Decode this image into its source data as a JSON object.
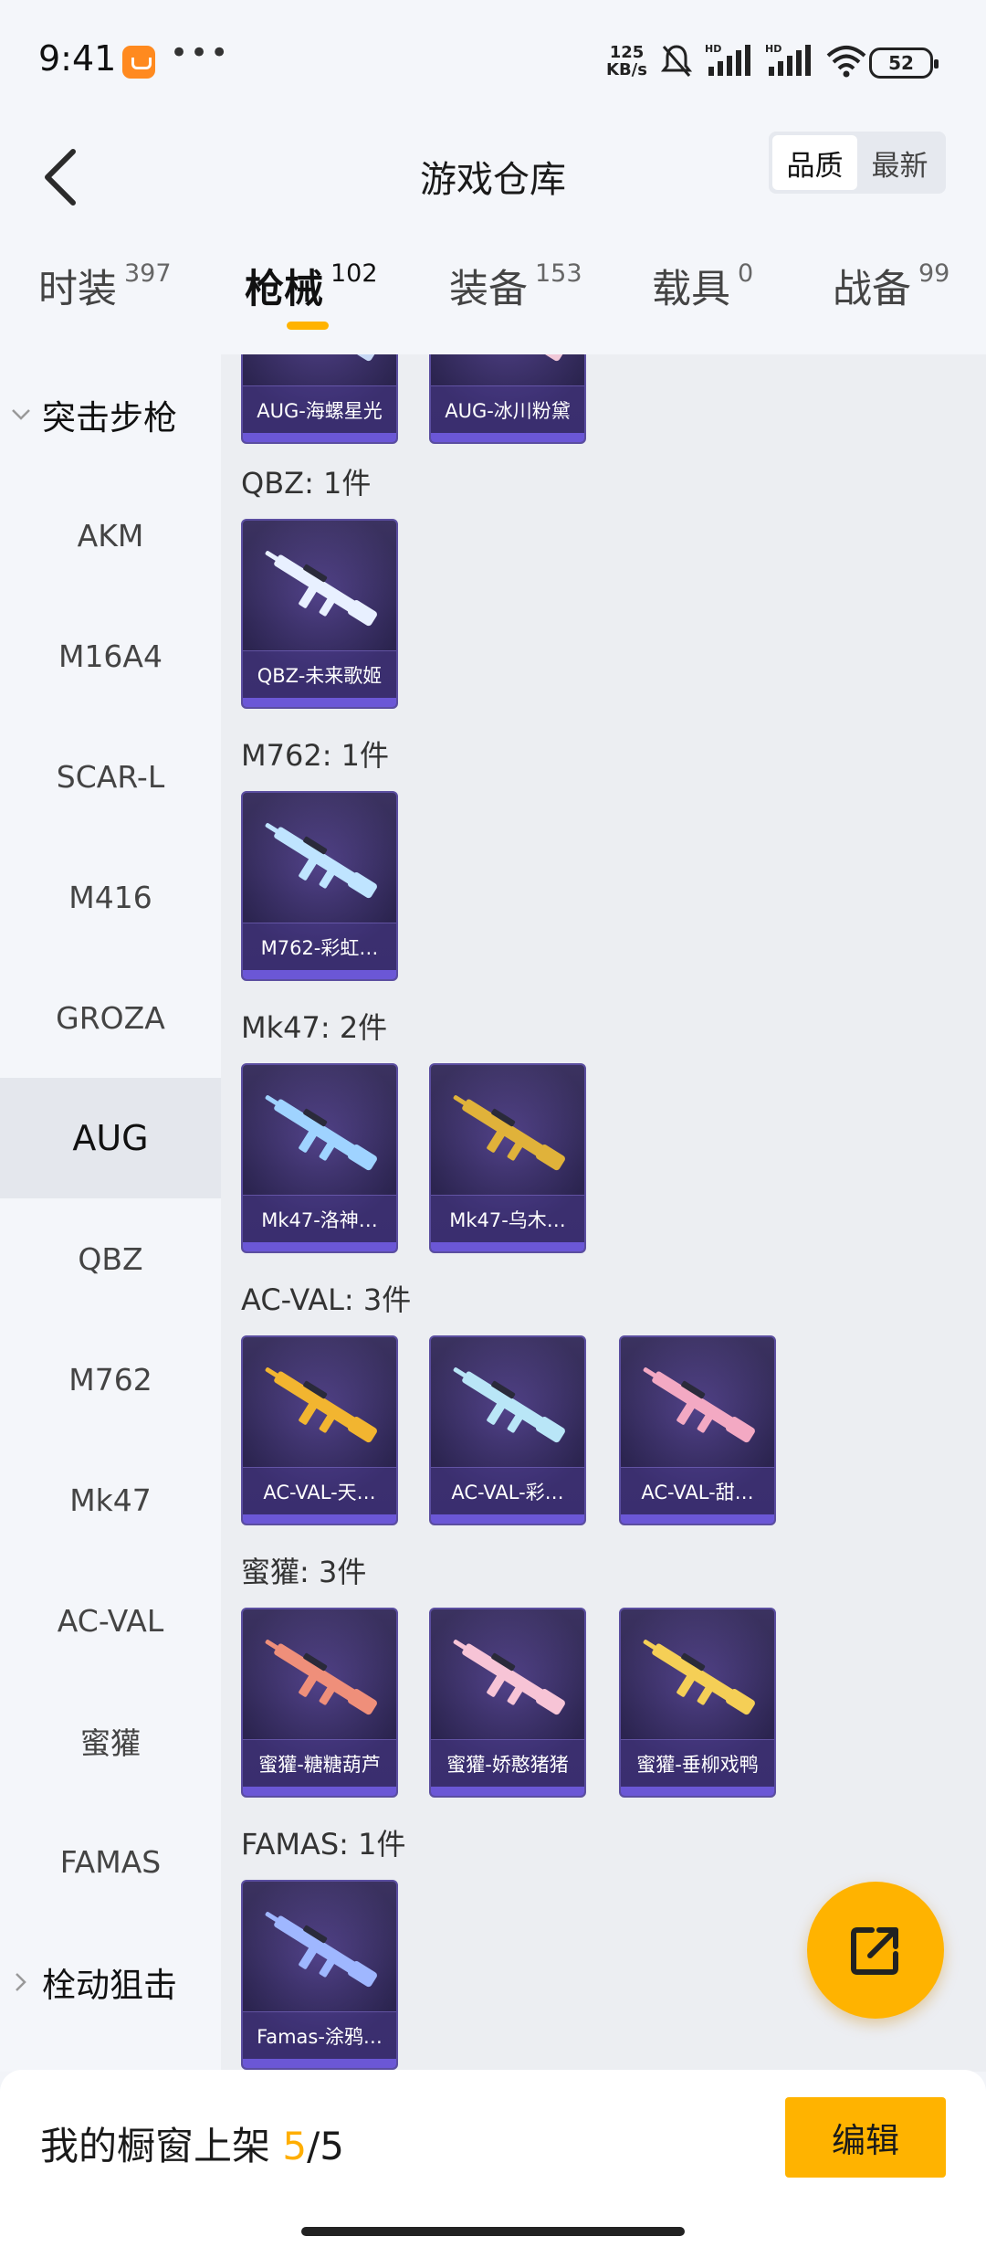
{
  "status_bar": {
    "time": "9:41",
    "more": "•••",
    "speed_value": "125",
    "speed_unit": "KB/s",
    "battery": "52"
  },
  "header": {
    "title": "游戏仓库",
    "sort_options": [
      "品质",
      "最新"
    ],
    "sort_selected": "品质"
  },
  "category_tabs": [
    {
      "label": "时装",
      "count": "397"
    },
    {
      "label": "枪械",
      "count": "102"
    },
    {
      "label": "装备",
      "count": "153"
    },
    {
      "label": "载具",
      "count": "0"
    },
    {
      "label": "战备",
      "count": "99"
    }
  ],
  "active_category": "枪械",
  "sidebar": {
    "group_open": "突击步枪",
    "items": [
      "AKM",
      "M16A4",
      "SCAR-L",
      "M416",
      "GROZA",
      "AUG",
      "QBZ",
      "M762",
      "Mk47",
      "AC-VAL",
      "蜜獾",
      "FAMAS"
    ],
    "active_item": "AUG",
    "group_closed": "栓动狙击"
  },
  "sections": [
    {
      "title": "",
      "items": [
        "AUG-海螺星光",
        "AUG-冰川粉黛"
      ]
    },
    {
      "title": "QBZ: 1件",
      "items": [
        "QBZ-未来歌姬"
      ]
    },
    {
      "title": "M762: 1件",
      "items": [
        "M762-彩虹…"
      ]
    },
    {
      "title": "Mk47: 2件",
      "items": [
        "Mk47-洛神…",
        "Mk47-乌木…"
      ]
    },
    {
      "title": "AC-VAL: 3件",
      "items": [
        "AC-VAL-天…",
        "AC-VAL-彩…",
        "AC-VAL-甜…"
      ]
    },
    {
      "title": "蜜獾: 3件",
      "items": [
        "蜜獾-糖糖葫芦",
        "蜜獾-娇憨猪猪",
        "蜜獾-垂柳戏鸭"
      ]
    },
    {
      "title": "FAMAS: 1件",
      "items": [
        "Famas-涂鸦…"
      ]
    }
  ],
  "gun_colors": [
    "#c8d9f5",
    "#f0c8d8",
    "#e8f0ff",
    "#bfe4ff",
    "#9fd3ff",
    "#e0b23a",
    "#f2b530",
    "#b9e6f7",
    "#f3a9c3",
    "#ef8f7a",
    "#f7c4d6",
    "#f5cf56",
    "#9fb7ff"
  ],
  "bottom_bar": {
    "label": "我的橱窗上架",
    "current": "5",
    "total": "/5",
    "edit_button": "编辑"
  }
}
